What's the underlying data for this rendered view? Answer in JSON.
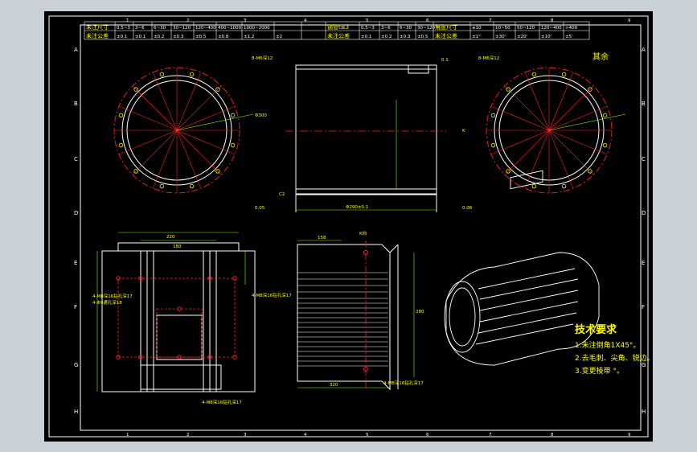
{
  "border": {
    "top_numbers": [
      "1",
      "2",
      "3",
      "4",
      "5",
      "6",
      "7",
      "8",
      "9"
    ],
    "bottom_numbers": [
      "1",
      "2",
      "3",
      "4",
      "5",
      "6",
      "7",
      "8",
      "9"
    ],
    "side_letters": [
      "A",
      "B",
      "C",
      "D",
      "E",
      "F",
      "G",
      "H"
    ]
  },
  "tolerance_table": {
    "row1_label": "未注尺寸",
    "row1": [
      "0.5~3",
      "3~6",
      "6~30",
      "30~120",
      "120~400",
      "400~1000",
      "1000~2000"
    ],
    "row2_label": "未注公差",
    "row2": [
      "±0.1",
      "±0.1",
      "±0.2",
      "±0.3",
      "±0.5",
      "±0.8",
      "±1.2",
      "±2"
    ],
    "mid_label1": "钢管t≤3",
    "mid_row1": [
      "0.5~3",
      "3~6",
      "6~30",
      "30~120"
    ],
    "mid_label2": "未注公差",
    "mid_row2": [
      "±0.1",
      "±0.2",
      "±0.3",
      "±0.5"
    ],
    "angle_label1": "角度尺寸",
    "angle_row1": [
      "≤10",
      "10~50",
      "50~120",
      "120~400",
      ">400"
    ],
    "angle_label2": "未注公差",
    "angle_row2": [
      "±1°",
      "±30'",
      "±20'",
      "±10'",
      "±5'"
    ]
  },
  "annotations": {
    "holes_left": "8-M6深12",
    "holes_right": "8-M6深12",
    "flatness": "0.1",
    "roundness": "0.05",
    "perp": "0.06",
    "other": "其余",
    "datum_k": "K",
    "dim_center": "Φ300",
    "dim_left_small": "C2",
    "dim_bottom": "Φ290±0.1",
    "hole_left_e": "4-M8深16钻孔深17",
    "hole_left_f": "4-Φ9通孔深18",
    "hole_bottom_g": "4-M8深16钻孔深17",
    "hole_right_e": "4-M8深16钻孔深17",
    "hole_section_bottom": "4-M8深16钻孔深17",
    "view_label": "K向",
    "dim_top_block": "220",
    "dim_top_block2": "180",
    "dim_section_top": "158",
    "dim_section_bottom": "320",
    "dim_section_right": "280",
    "dim_mid_vertical": "240"
  },
  "tech_requirements": {
    "title": "技术要求",
    "items": [
      "1.未注倒角1X45°。",
      "2.去毛刺、尖角、锐边。",
      "3.变更棱带  °。"
    ]
  },
  "colors": {
    "frame": "#ffffff",
    "dimension": "#00ff66",
    "centerline": "#ff2020",
    "text": "#ffff00",
    "highlight": "#ff2fd0"
  }
}
